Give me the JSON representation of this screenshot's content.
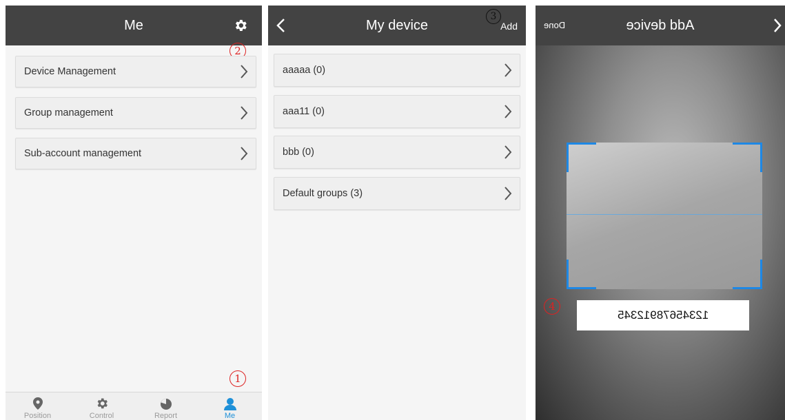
{
  "me_screen": {
    "title": "Me",
    "marker_settings": "2",
    "marker_me_tab": "1",
    "menu_items": [
      {
        "label": "Device Management"
      },
      {
        "label": "Group management"
      },
      {
        "label": "Sub-account management"
      }
    ],
    "nav": [
      {
        "label": "Position",
        "icon": "location-pin-icon"
      },
      {
        "label": "Control",
        "icon": "gear-icon"
      },
      {
        "label": "Report",
        "icon": "pie-chart-icon"
      },
      {
        "label": "Me",
        "icon": "person-icon",
        "active": true
      }
    ]
  },
  "device_screen": {
    "title": "My device",
    "add_label": "Add",
    "marker_add": "3",
    "groups": [
      {
        "label": "aaaaa (0)"
      },
      {
        "label": "aaa11 (0)"
      },
      {
        "label": "bbb (0)"
      },
      {
        "label": "Default groups (3)"
      }
    ]
  },
  "scan_screen": {
    "title": "Add device",
    "done_label": "Done",
    "code_value": "12345678912345",
    "marker_code": "4"
  },
  "colors": {
    "topbar": "#434343",
    "accent": "#1e90d8",
    "marker_red": "#dd2222"
  }
}
